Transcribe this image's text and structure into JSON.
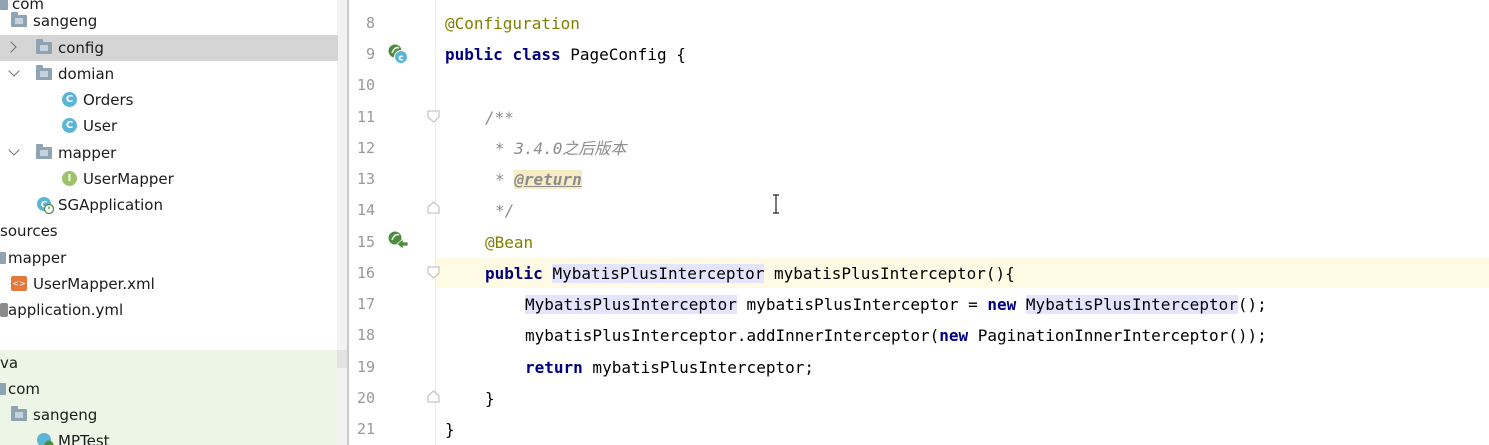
{
  "tree": {
    "items": [
      {
        "label": "com",
        "kind": "folder"
      },
      {
        "label": "sangeng",
        "kind": "package"
      },
      {
        "label": "config",
        "kind": "package",
        "expanded": false,
        "selected": true
      },
      {
        "label": "domian",
        "kind": "package",
        "expanded": true
      },
      {
        "label": "Orders",
        "kind": "class",
        "icon_letter": "C"
      },
      {
        "label": "User",
        "kind": "class",
        "icon_letter": "C"
      },
      {
        "label": "mapper",
        "kind": "package",
        "expanded": true
      },
      {
        "label": "UserMapper",
        "kind": "interface",
        "icon_letter": "I"
      },
      {
        "label": "SGApplication",
        "kind": "spring-boot-class"
      },
      {
        "label": "sources",
        "kind": "folder"
      },
      {
        "label": "mapper",
        "kind": "folder"
      },
      {
        "label": "UserMapper.xml",
        "kind": "xml-file",
        "icon_letter": "<>"
      },
      {
        "label": "application.yml",
        "kind": "yml-file"
      },
      {
        "label": "va",
        "kind": "folder"
      },
      {
        "label": "com",
        "kind": "folder"
      },
      {
        "label": "sangeng",
        "kind": "package"
      },
      {
        "label": "MPTest",
        "kind": "test-class"
      }
    ]
  },
  "editor": {
    "lines": [
      {
        "n": "8",
        "text": "@Configuration"
      },
      {
        "n": "9",
        "text": "public class PageConfig {"
      },
      {
        "n": "10",
        "text": ""
      },
      {
        "n": "11",
        "text": "/**"
      },
      {
        "n": "12",
        "text": "* 3.4.0之后版本"
      },
      {
        "n": "13",
        "text": "* @return"
      },
      {
        "n": "14",
        "text": "*/"
      },
      {
        "n": "15",
        "text": "@Bean"
      },
      {
        "n": "16",
        "text": "public MybatisPlusInterceptor mybatisPlusInterceptor(){"
      },
      {
        "n": "17",
        "text": "MybatisPlusInterceptor mybatisPlusInterceptor = new MybatisPlusInterceptor();"
      },
      {
        "n": "18",
        "text": "mybatisPlusInterceptor.addInnerInterceptor(new PaginationInnerInterceptor());"
      },
      {
        "n": "19",
        "text": "return mybatisPlusInterceptor;"
      },
      {
        "n": "20",
        "text": "}"
      },
      {
        "n": "21",
        "text": "}"
      }
    ],
    "tokens": {
      "configuration": "@Configuration",
      "public": "public",
      "class": "class",
      "page_config": "PageConfig {",
      "doc_open": "/**",
      "doc_version": "* 3.4.0之后版本",
      "star": "* ",
      "return_tag": "@return",
      "doc_close": "*/",
      "bean": "@Bean",
      "mpi_type": "MybatisPlusInterceptor",
      "mpi_method": " mybatisPlusInterceptor(){",
      "mpi_var_assign": " mybatisPlusInterceptor = ",
      "new": "new",
      "space": " ",
      "call_end": "();",
      "add_inner": "mybatisPlusInterceptor.addInnerInterceptor(",
      "pagination": " PaginationInnerInterceptor());",
      "return": "return",
      "return_var": " mybatisPlusInterceptor;",
      "close_brace": "}"
    }
  },
  "colors": {
    "keyword": "#000080",
    "annotation": "#808000",
    "comment": "#8c8c8c",
    "current_line": "#fffae3",
    "identifier_highlight": "#e4e4ff",
    "selected_row": "#d5d5d5",
    "test_source_bg": "#edf5e6"
  }
}
